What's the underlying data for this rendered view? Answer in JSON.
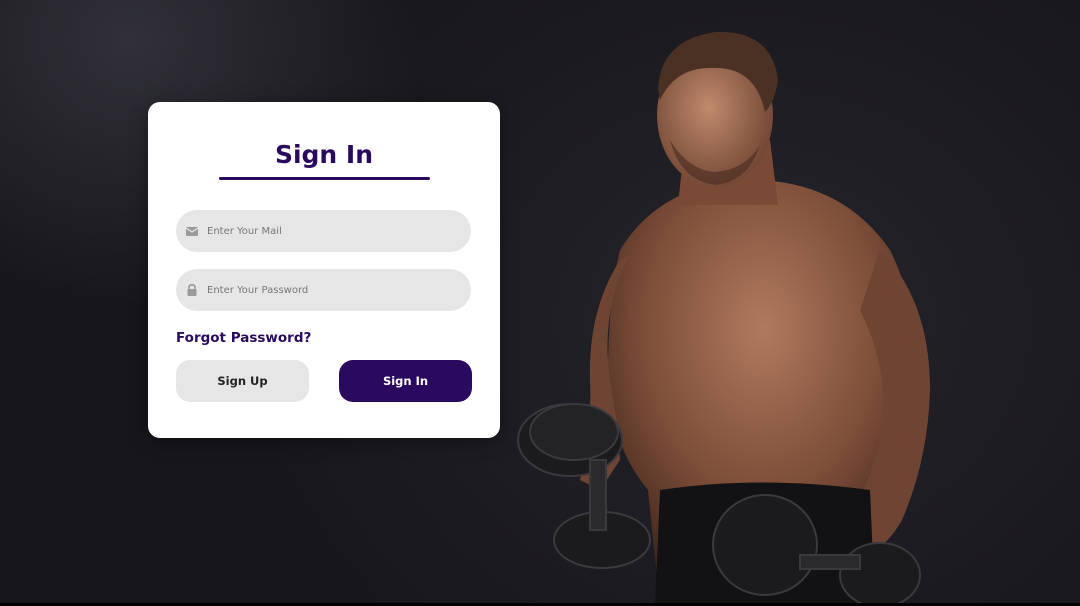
{
  "login": {
    "title": "Sign In",
    "email_placeholder": "Enter Your Mail",
    "password_placeholder": "Enter Your Password",
    "forgot_label": "Forgot Password?",
    "signup_label": "Sign Up",
    "signin_label": "Sign In"
  },
  "icons": {
    "email": "envelope-icon",
    "password": "lock-icon"
  },
  "colors": {
    "brand": "#2a0a5e",
    "input_bg": "#e6e6e6",
    "card_bg": "#ffffff",
    "background": "#1a191f"
  }
}
